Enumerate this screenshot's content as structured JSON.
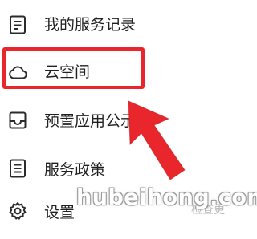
{
  "menu": {
    "items": [
      {
        "label": "我的服务记录",
        "icon": "document-list-icon"
      },
      {
        "label": "云空间",
        "icon": "cloud-icon"
      },
      {
        "label": "预置应用公示",
        "icon": "inbox-tray-icon"
      },
      {
        "label": "服务政策",
        "icon": "policy-document-icon"
      },
      {
        "label": "设置",
        "icon": "gear-icon"
      }
    ],
    "highlighted_item": "云空间"
  },
  "annotation": {
    "highlight_color": "#e8262c"
  },
  "faded_right_text": "检查更",
  "watermark": {
    "text": "hubeihong.com",
    "note": "watermark"
  },
  "colors": {
    "text": "#1f1f1f",
    "icon": "#2b2b2b",
    "background": "#ffffff",
    "annotation_red": "#e8262c"
  }
}
